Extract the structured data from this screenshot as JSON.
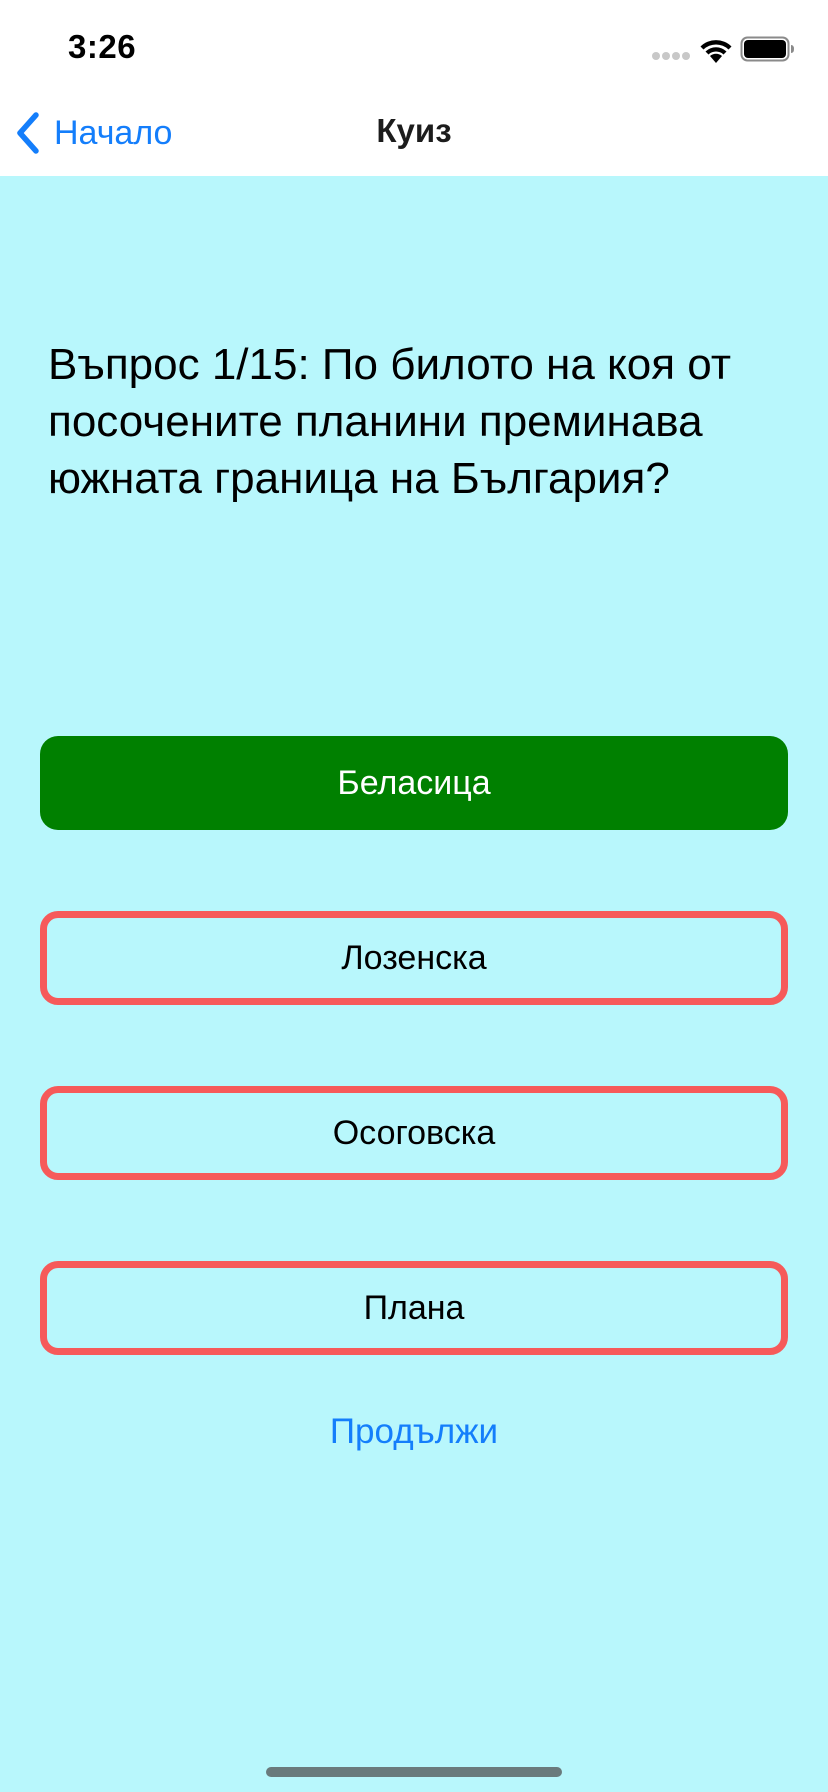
{
  "status_bar": {
    "time": "3:26",
    "icons": [
      "cellular-signal-icon",
      "wifi-icon",
      "battery-icon"
    ]
  },
  "nav": {
    "back_label": "Начало",
    "back_icon": "chevron-left-icon",
    "title": "Куиз"
  },
  "quiz": {
    "question": "Въпрос 1/15: По билото на коя от посочените планини преминава южната граница на България?",
    "answers": [
      {
        "label": "Беласица",
        "state": "correct"
      },
      {
        "label": "Лозенска",
        "state": "wrong"
      },
      {
        "label": "Осоговска",
        "state": "wrong"
      },
      {
        "label": "Плана",
        "state": "wrong"
      }
    ],
    "continue_label": "Продължи"
  },
  "colors": {
    "background": "#b8f7fc",
    "accent": "#147efb",
    "correct_fill": "#008000",
    "wrong_border": "#f65a5a"
  }
}
